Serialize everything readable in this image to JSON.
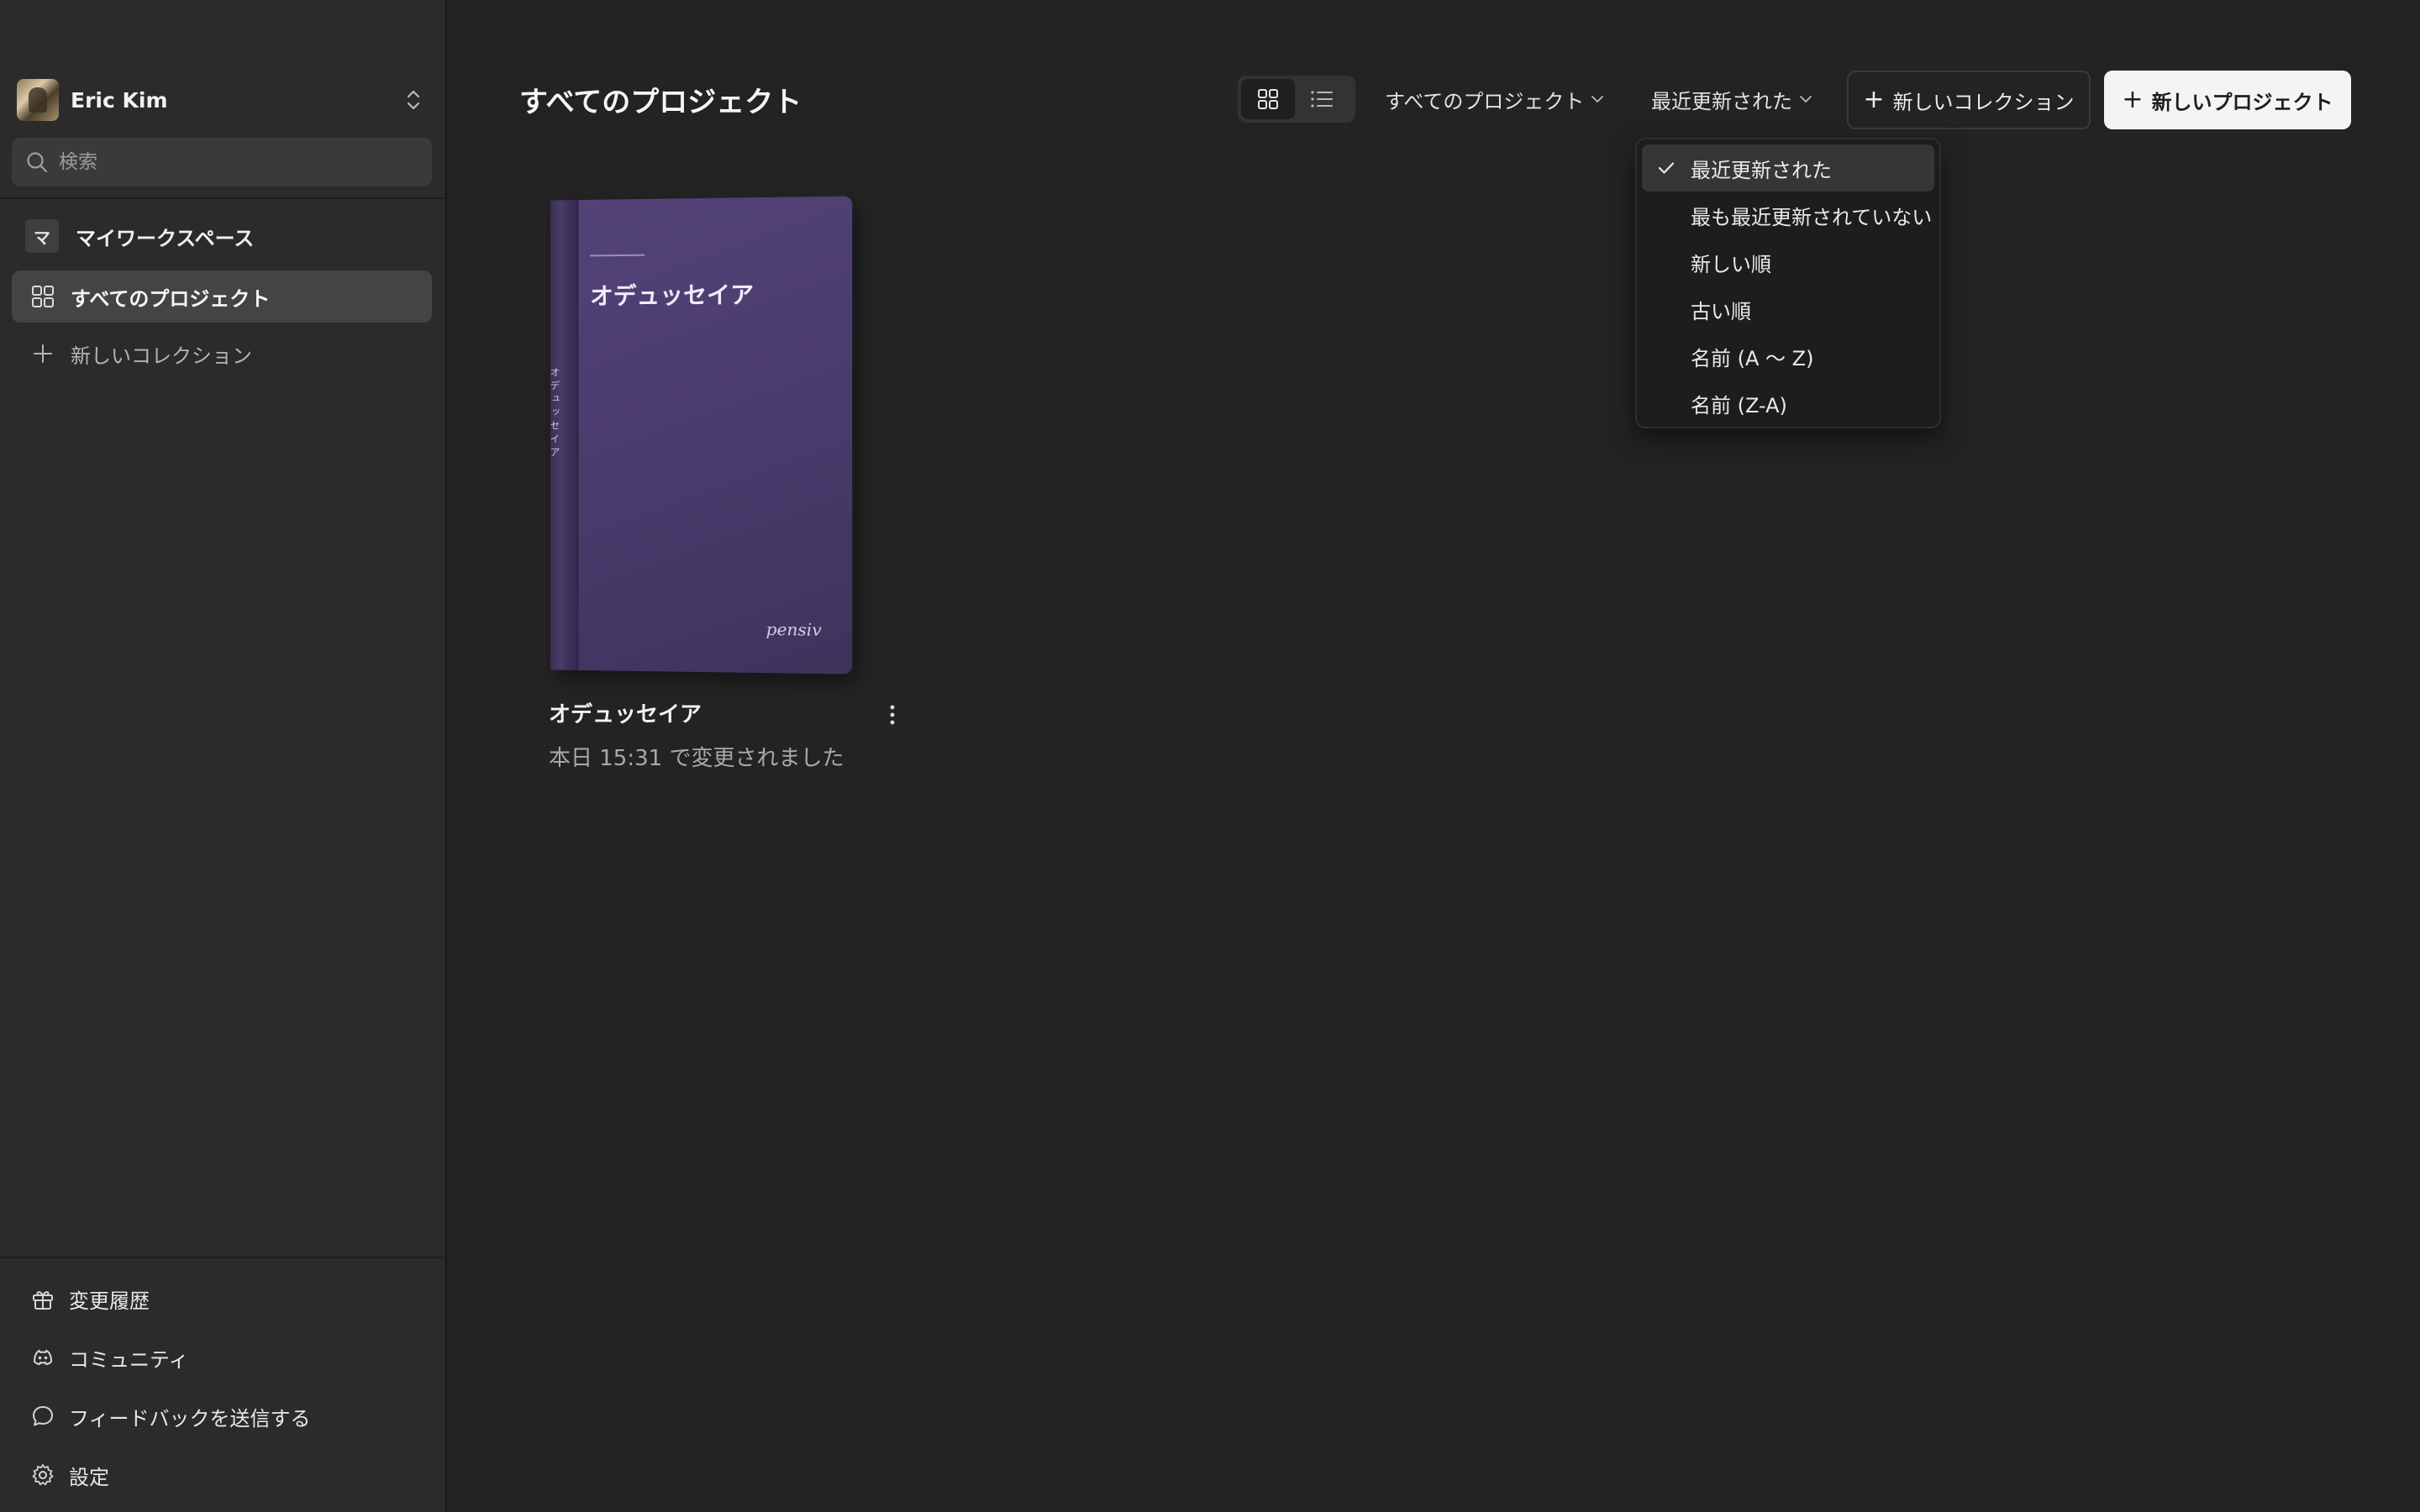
{
  "user": {
    "name": "Eric Kim"
  },
  "search": {
    "placeholder": "検索"
  },
  "sidebar": {
    "workspace": {
      "badge": "マ",
      "label": "マイワークスペース"
    },
    "items": [
      {
        "label": "すべてのプロジェクト",
        "active": true
      },
      {
        "label": "新しいコレクション",
        "icon": "plus-icon"
      }
    ],
    "footer": [
      {
        "label": "変更履歴",
        "icon": "gift-icon"
      },
      {
        "label": "コミュニティ",
        "icon": "discord-icon"
      },
      {
        "label": "フィードバックを送信する",
        "icon": "chat-bubble-icon"
      },
      {
        "label": "設定",
        "icon": "gear-icon"
      }
    ]
  },
  "header": {
    "title": "すべてのプロジェクト",
    "view_modes": [
      "grid-icon",
      "list-icon"
    ],
    "filter_label": "すべてのプロジェクト",
    "sort_label": "最近更新された",
    "new_collection_label": "新しいコレクション",
    "new_project_label": "新しいプロジェクト"
  },
  "sort_menu": {
    "options": [
      {
        "label": "最近更新された",
        "selected": true
      },
      {
        "label": "最も最近更新されていない"
      },
      {
        "label": "新しい順"
      },
      {
        "label": "古い順"
      },
      {
        "label": "名前 (A ～ Z)"
      },
      {
        "label": "名前 (Z-A)"
      }
    ]
  },
  "projects": [
    {
      "title": "オデュッセイア",
      "cover_title": "オデュッセイア",
      "spine_text": "オデュッセイア",
      "cover_logo": "pensiv",
      "modified": "本日 15:31 で変更されました"
    }
  ],
  "colors": {
    "sidebar_bg": "#2b2b2b",
    "main_bg": "#232323",
    "cover": "#4a3b6d",
    "primary_button": "#f4f4f4"
  }
}
